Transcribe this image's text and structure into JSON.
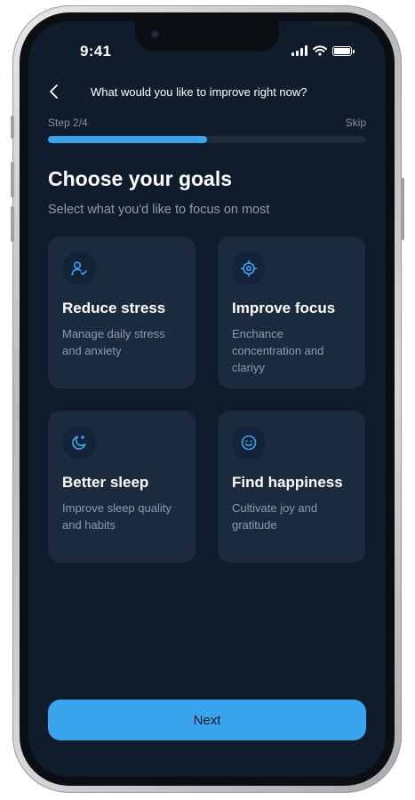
{
  "status_bar": {
    "time": "9:41"
  },
  "header": {
    "title": "What would you like to improve right now?"
  },
  "progress": {
    "step_label": "Step 2/4",
    "skip_label": "Skip",
    "fraction": 0.5
  },
  "page": {
    "title": "Choose your goals",
    "subtitle": "Select what you'd like to focus on most"
  },
  "goals": [
    {
      "icon": "user-check-icon",
      "title": "Reduce stress",
      "description": "Manage daily stress and anxiety"
    },
    {
      "icon": "target-icon",
      "title": "Improve focus",
      "description": "Enchance concentration and clariyy"
    },
    {
      "icon": "moon-icon",
      "title": "Better sleep",
      "description": "Improve sleep quality and habits"
    },
    {
      "icon": "smile-icon",
      "title": "Find happiness",
      "description": "Cultivate joy and gratitude"
    }
  ],
  "footer": {
    "next_label": "Next"
  },
  "colors": {
    "accent": "#3aa4ee",
    "background": "#0f1c2c",
    "card": "#1c2a3d",
    "muted_text": "#8e9bb0"
  }
}
